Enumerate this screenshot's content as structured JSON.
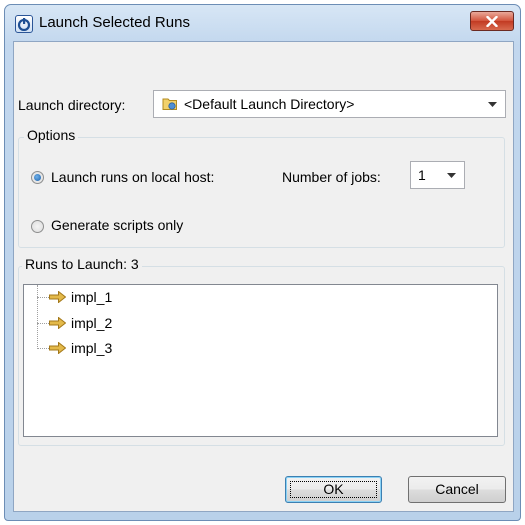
{
  "window": {
    "title": "Launch Selected Runs"
  },
  "launch_directory": {
    "label": "Launch directory:",
    "value": "<Default Launch Directory>"
  },
  "options": {
    "title": "Options",
    "radio_local": {
      "label": "Launch runs on local host:",
      "checked": true
    },
    "jobs": {
      "label": "Number of jobs:",
      "value": "1"
    },
    "radio_scripts": {
      "label": "Generate scripts only",
      "checked": false
    }
  },
  "runs": {
    "title": "Runs to Launch: 3",
    "items": [
      {
        "label": "impl_1"
      },
      {
        "label": "impl_2"
      },
      {
        "label": "impl_3"
      }
    ]
  },
  "buttons": {
    "ok": "OK",
    "cancel": "Cancel"
  },
  "colors": {
    "accent": "#3c7fb1",
    "arrow": "#e0b53a",
    "close": "#c23a22"
  }
}
